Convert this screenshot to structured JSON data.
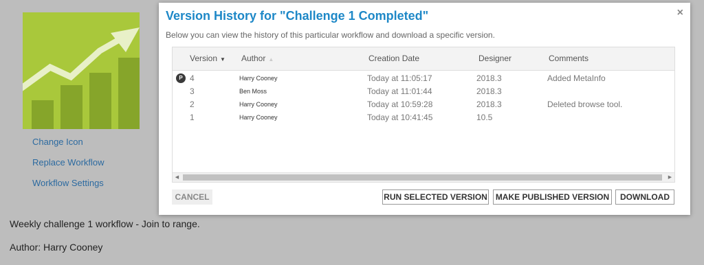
{
  "background": {
    "links": [
      "Change Icon",
      "Replace Workflow",
      "Workflow Settings"
    ],
    "description": "Weekly challenge 1 workflow - Join to range.",
    "author_line": "Author: Harry Cooney"
  },
  "modal": {
    "title": "Version History for \"Challenge 1 Completed\"",
    "subtitle": "Below you can view the history of this particular workflow and download a specific version.",
    "close_glyph": "×",
    "columns": {
      "version": "Version",
      "author": "Author",
      "creation_date": "Creation Date",
      "designer": "Designer",
      "comments": "Comments"
    },
    "rows": [
      {
        "published_badge": "P",
        "version": "4",
        "author": "Harry Cooney",
        "creation_date": "Today at 11:05:17",
        "designer": "2018.3",
        "comments": "Added MetaInfo"
      },
      {
        "version": "3",
        "author": "Ben Moss",
        "creation_date": "Today at 11:01:44",
        "designer": "2018.3",
        "comments": ""
      },
      {
        "version": "2",
        "author": "Harry Cooney",
        "creation_date": "Today at 10:59:28",
        "designer": "2018.3",
        "comments": "Deleted browse tool."
      },
      {
        "version": "1",
        "author": "Harry Cooney",
        "creation_date": "Today at 10:41:45",
        "designer": "10.5",
        "comments": ""
      }
    ],
    "buttons": {
      "cancel": "CANCEL",
      "run": "RUN SELECTED VERSION",
      "publish": "MAKE PUBLISHED VERSION",
      "download": "DOWNLOAD"
    }
  },
  "colors": {
    "accent": "#1e88c7",
    "icon_bg": "#a8c73a",
    "link": "#2c6aa0"
  }
}
